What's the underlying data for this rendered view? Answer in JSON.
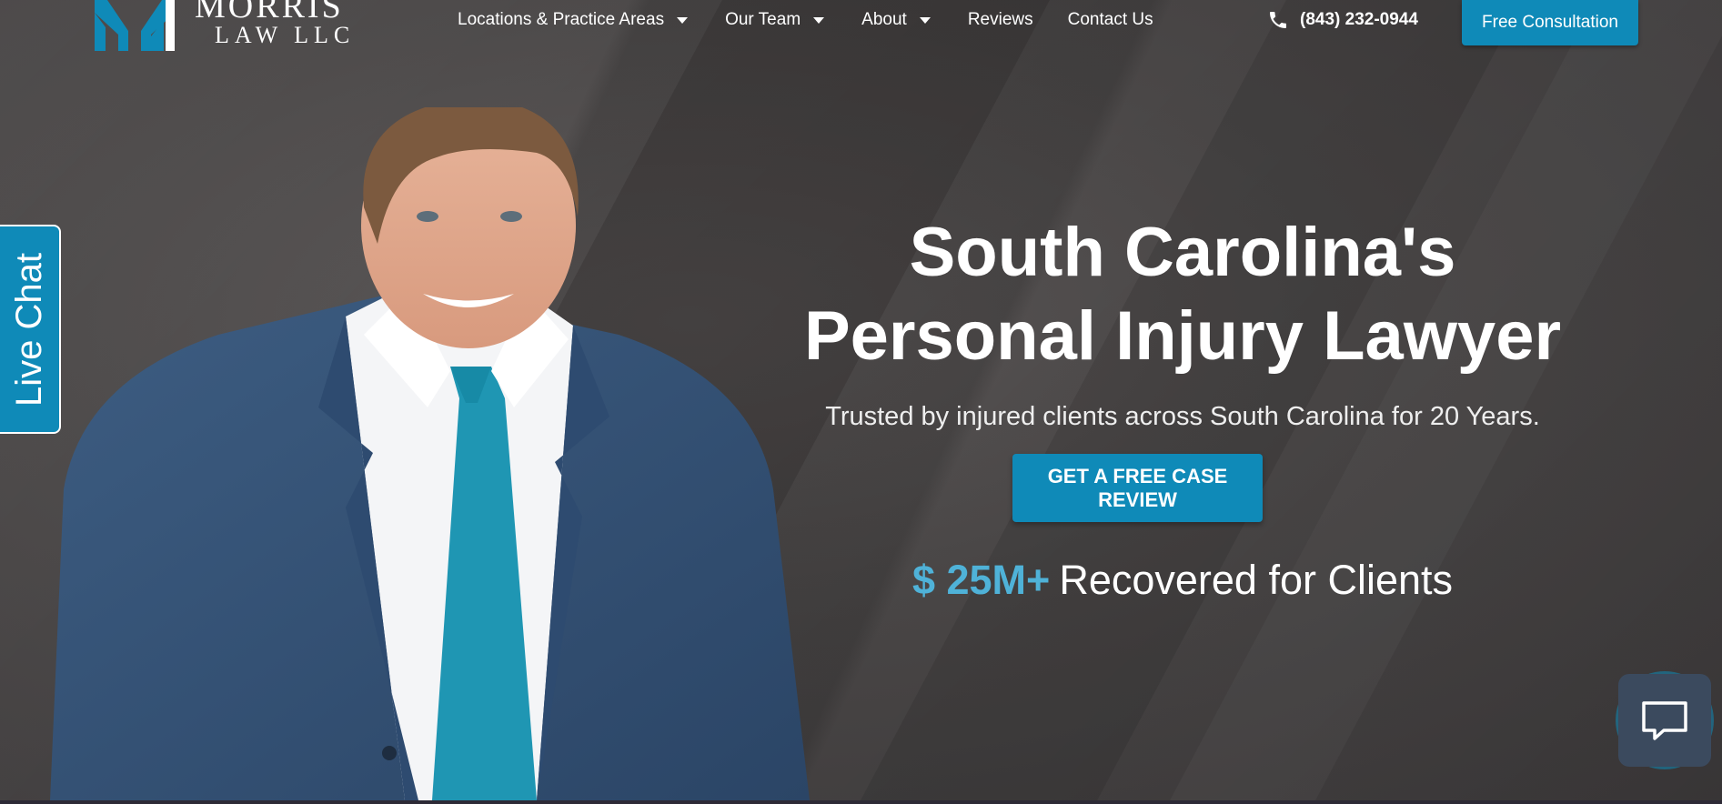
{
  "brand": {
    "name_line1": "MORRIS",
    "name_line2": "LAW LLC",
    "accent_color": "#0f8ab8"
  },
  "nav": {
    "items": [
      {
        "label": "Locations & Practice Areas",
        "has_dropdown": true
      },
      {
        "label": "Our Team",
        "has_dropdown": true
      },
      {
        "label": "About",
        "has_dropdown": true
      },
      {
        "label": "Reviews",
        "has_dropdown": false
      },
      {
        "label": "Contact Us",
        "has_dropdown": false
      }
    ],
    "phone": "(843) 232-0944",
    "phone_icon": "phone-icon",
    "consult_label": "Free Consultation"
  },
  "live_chat": {
    "label": "Live Chat"
  },
  "hero": {
    "headline_line1": "South Carolina's",
    "headline_line2": "Personal Injury Lawyer",
    "subline": "Trusted by injured clients across South Carolina for 20 Years.",
    "cta_label": "GET A FREE CASE REVIEW",
    "stat_amount": "$ 25M+",
    "stat_label": "Recovered for Clients"
  },
  "chat_widget": {
    "icon": "chat-bubble-icon"
  }
}
